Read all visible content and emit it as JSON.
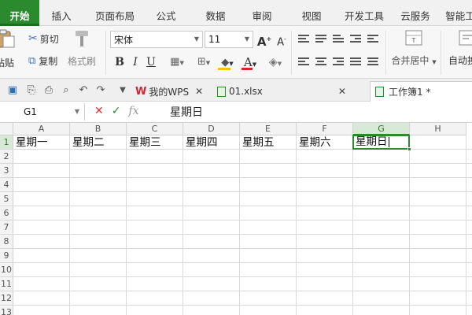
{
  "ribbon_tabs": [
    "开始",
    "插入",
    "页面布局",
    "公式",
    "数据",
    "审阅",
    "视图",
    "开发工具",
    "云服务",
    "智能工"
  ],
  "clipboard": {
    "paste": "粘贴",
    "cut": "剪切",
    "copy": "复制",
    "format_painter": "格式刷"
  },
  "font": {
    "name": "宋体",
    "size": "11"
  },
  "format_buttons": [
    "B",
    "I",
    "U"
  ],
  "merge_label": "合并居中",
  "wrap_label": "自动换行",
  "doc_tabs": [
    {
      "label": "我的WPS"
    },
    {
      "label": "01.xlsx"
    },
    {
      "label": "工作簿1 *"
    }
  ],
  "formula_bar": {
    "name_box": "G1",
    "content": "星期日",
    "fx": "fx"
  },
  "columns": [
    "A",
    "B",
    "C",
    "D",
    "E",
    "F",
    "G",
    "H"
  ],
  "selected_column": "G",
  "rows": [
    "1",
    "2",
    "3",
    "4",
    "5",
    "6",
    "7",
    "8",
    "9",
    "10",
    "11",
    "12",
    "13"
  ],
  "row1_cells": [
    "星期一",
    "星期二",
    "星期三",
    "星期四",
    "星期五",
    "星期六",
    "星期日"
  ],
  "active_cell": "G1",
  "colors": {
    "accent": "#2a8a2d"
  }
}
